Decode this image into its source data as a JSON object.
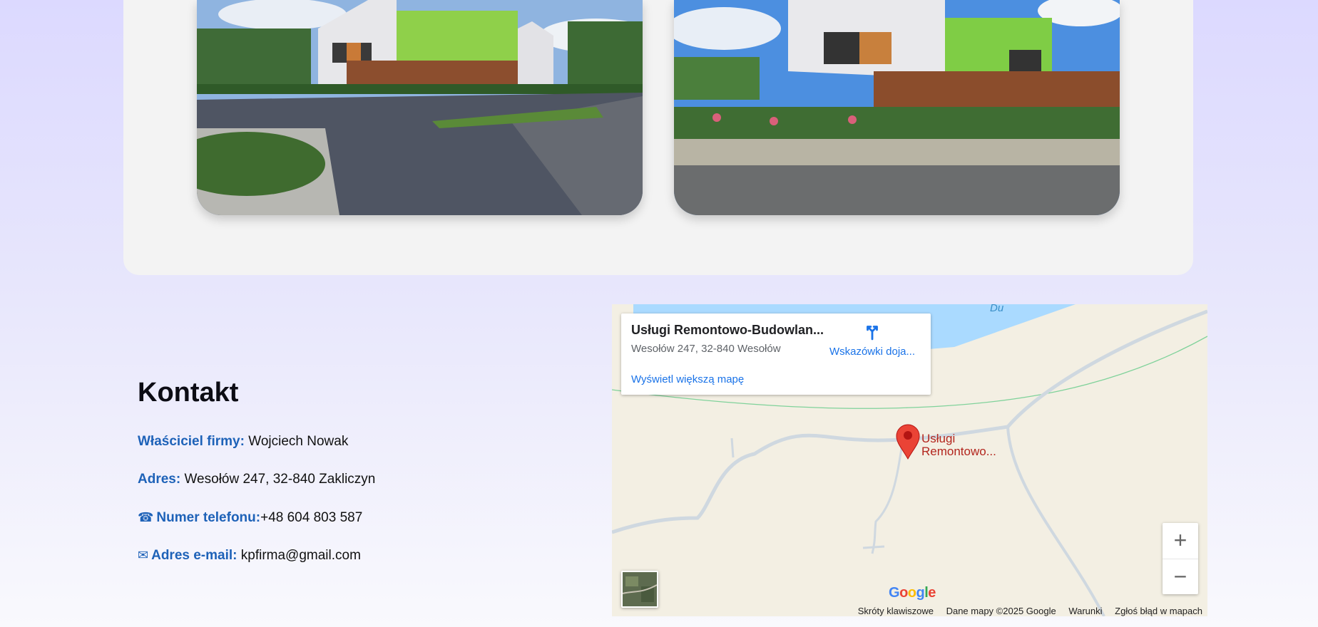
{
  "gallery": {
    "photos": [
      {
        "alt": "building-photo-1"
      },
      {
        "alt": "building-photo-2"
      }
    ]
  },
  "contact": {
    "heading": "Kontakt",
    "owner_label": "Właściciel firmy:",
    "owner_value": "Wojciech Nowak",
    "address_label": "Adres:",
    "address_value": "Wesołów 247, 32-840 Zakliczyn",
    "phone_icon": "☎",
    "phone_label": "Numer telefonu:",
    "phone_value": "+48 604 803 587",
    "email_icon": "✉",
    "email_label": "Adres e-mail:",
    "email_value": "kpfirma@gmail.com"
  },
  "map": {
    "place_title": "Usługi Remontowo-Budowlan...",
    "place_address": "Wesołów 247, 32-840 Wesołów",
    "view_larger": "Wyświetl większą mapę",
    "directions_label": "Wskazówki doja...",
    "pin_label_line1": "Usługi",
    "pin_label_line2": "Remontowo...",
    "water_label": "Du",
    "zoom_in": "+",
    "zoom_out": "−",
    "footer": {
      "shortcuts": "Skróty klawiszowe",
      "map_data": "Dane mapy ©2025 Google",
      "terms": "Warunki",
      "report": "Zgłoś błąd w mapach"
    },
    "colors": {
      "land": "#f3efe3",
      "water": "#aadaff",
      "road": "#cfd8e0",
      "pin": "#ea4335"
    }
  }
}
